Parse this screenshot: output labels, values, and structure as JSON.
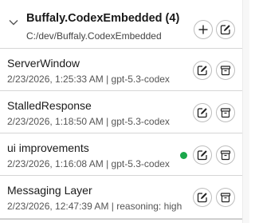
{
  "group": {
    "title": "Buffaly.CodexEmbedded (4)",
    "path": "C:/dev/Buffaly.CodexEmbedded",
    "icons": {
      "toggle": "chevron-down-icon",
      "add": "plus-icon",
      "edit": "edit-icon"
    }
  },
  "sessions": [
    {
      "name": "ServerWindow",
      "meta": "2/23/2026, 1:25:33 AM | gpt-5.3-codex",
      "active": false
    },
    {
      "name": "StalledResponse",
      "meta": "2/23/2026, 1:18:50 AM | gpt-5.3-codex",
      "active": false
    },
    {
      "name": "ui improvements",
      "meta": "2/23/2026, 1:16:08 AM | gpt-5.3-codex",
      "active": true
    },
    {
      "name": "Messaging Layer",
      "meta": "2/23/2026, 12:47:39 AM | reasoning: high",
      "active": false
    }
  ],
  "colors": {
    "active_dot": "#1aa74a",
    "divider": "#d6d6d6",
    "button_border": "#bdbdbd"
  }
}
